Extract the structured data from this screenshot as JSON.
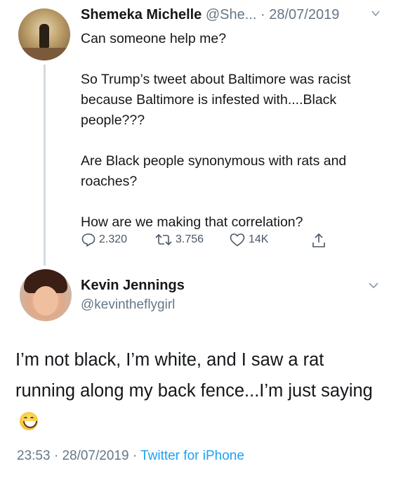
{
  "tweet1": {
    "name": "Shemeka Michelle",
    "handle": "@She...",
    "date": "28/07/2019",
    "text": "Can someone help me?\n\nSo Trump’s tweet about Baltimore was racist because Baltimore is infested with....Black people???\n\nAre Black people synonymous with rats and roaches?\n\nHow are we making that correlation?",
    "replies": "2.320",
    "retweets": "3.756",
    "likes": "14K"
  },
  "tweet2": {
    "name": "Kevin Jennings",
    "handle": "@kevintheflygirl",
    "text": "I’m not black, I’m white, and I saw a rat running along my back fence...I’m just saying",
    "emoji": "grinning-face-with-smiling-eyes",
    "time": "23:53",
    "date": "28/07/2019",
    "source": "Twitter for iPhone"
  },
  "icons": {
    "reply": "reply-icon",
    "retweet": "retweet-icon",
    "like": "heart-icon",
    "share": "share-icon",
    "menu": "chevron-down-icon"
  },
  "colors": {
    "secondary_text": "#657786",
    "link": "#1da1f2",
    "primary_text": "#14171a"
  }
}
